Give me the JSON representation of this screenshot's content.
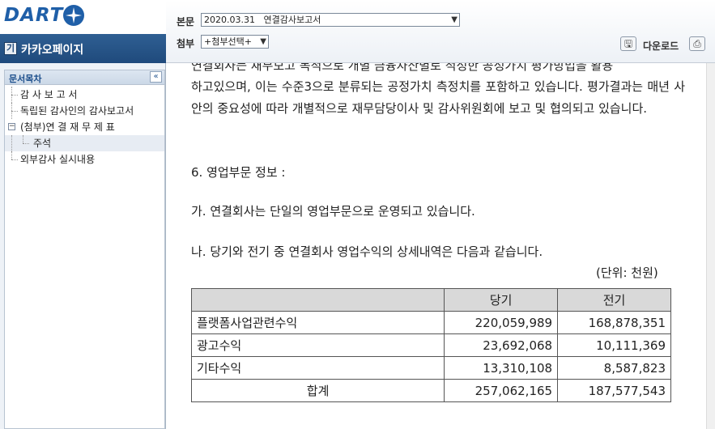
{
  "brand": {
    "logo_text": "DART",
    "company_icon": "기",
    "company_name": "카카오페이지"
  },
  "header": {
    "main_label": "본문",
    "main_select": "2020.03.31   연결감사보고서",
    "attach_label": "첨부",
    "attach_select": "+첨부선택+",
    "download_label": "다운로드"
  },
  "sidebar": {
    "title": "문서목차",
    "collapse_icon": "«",
    "items": [
      {
        "label": "감 사 보 고 서"
      },
      {
        "label": "독립된 감사인의 감사보고서"
      },
      {
        "label": "(첨부)연 결 재 무 제 표"
      },
      {
        "label": "주석"
      },
      {
        "label": "외부감사 실시내용"
      }
    ]
  },
  "content": {
    "cut_top_line": "연결회사는 재무보고 목적으로 개별 금융자산별로 적정한 공정가치 평가방법을 활용",
    "paragraph": "하고있으며, 이는 수준3으로 분류되는 공정가치 측정치를 포함하고 있습니다. 평가결과는 매년 사안의 중요성에 따라 개별적으로 재무담당이사 및 감사위원회에 보고 및 협의되고 있습니다.",
    "section_heading": "6. 영업부문 정보 :",
    "item_ga": "가. 연결회사는 단일의 영업부문으로 운영되고 있습니다.",
    "item_na": "나. 당기와 전기 중 연결회사 영업수익의 상세내역은 다음과 같습니다.",
    "unit": "(단위: 천원)"
  },
  "table": {
    "headers": [
      "",
      "당기",
      "전기"
    ],
    "rows": [
      [
        "플랫폼사업관련수익",
        "220,059,989",
        "168,878,351"
      ],
      [
        "광고수익",
        "23,692,068",
        "10,111,369"
      ],
      [
        "기타수익",
        "13,310,108",
        "8,587,823"
      ]
    ],
    "total": [
      "합계",
      "257,062,165",
      "187,577,543"
    ]
  }
}
